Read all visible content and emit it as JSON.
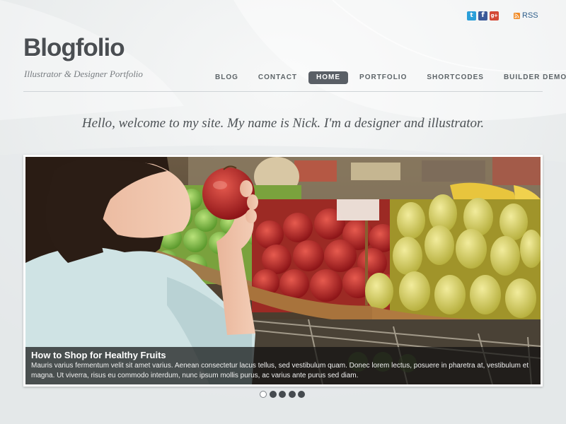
{
  "header": {
    "logo": "Blogfolio",
    "tagline": "Illustrator & Designer Portfolio"
  },
  "social": {
    "icons": [
      "twitter-icon",
      "facebook-icon",
      "google-plus-icon",
      "rss-icon"
    ],
    "twitter_glyph": "t",
    "facebook_glyph": "f",
    "google_plus_glyph": "g+",
    "rss_label": "RSS"
  },
  "nav": {
    "items": [
      {
        "label": "BLOG"
      },
      {
        "label": "CONTACT"
      },
      {
        "label": "HOME",
        "active": true
      },
      {
        "label": "PORTFOLIO"
      },
      {
        "label": "SHORTCODES"
      },
      {
        "label": "BUILDER DEMOS"
      }
    ]
  },
  "intro": {
    "text": "Hello, welcome to my site. My name is Nick. I'm a designer and illustrator."
  },
  "slider": {
    "image": "woman-holding-apple-at-fruit-market",
    "caption_title": "How to Shop for Healthy Fruits",
    "caption_text": "Mauris varius fermentum velit sit amet varius. Aenean consectetur lacus tellus, sed vestibulum quam. Donec lorem lectus, posuere in pharetra at, vestibulum et magna. Ut viverra, risus eu commodo interdum, nunc ipsum mollis purus, ac varius ante purus sed diam.",
    "slide_count": 5,
    "active_index": 0
  },
  "colors": {
    "background": "#e8ebec",
    "nav_active": "#5a5f66",
    "logo": "#4a4e52",
    "link": "#2d5d8a"
  }
}
